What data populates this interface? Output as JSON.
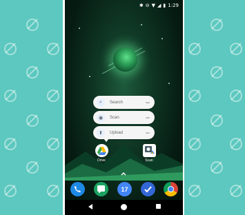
{
  "status_bar": {
    "time": "1:29"
  },
  "shortcuts": [
    {
      "label": "Search",
      "icon": "search-icon"
    },
    {
      "label": "Scan",
      "icon": "camera-icon"
    },
    {
      "label": "Upload",
      "icon": "upload-icon"
    }
  ],
  "home_apps": [
    {
      "label": "Drive",
      "icon": "google-drive-icon"
    },
    {
      "label": "Scan",
      "icon": "drive-scan-icon"
    }
  ],
  "dock": [
    {
      "icon": "phone-icon",
      "color": "#1e88e5"
    },
    {
      "icon": "messages-icon",
      "color": "#1aa260"
    },
    {
      "icon": "calendar-icon",
      "label": "17",
      "color": "#4285f4"
    },
    {
      "icon": "tasks-icon",
      "color": "#3367d6"
    },
    {
      "icon": "chrome-icon",
      "color": "#db4437"
    }
  ],
  "colors": {
    "side_panel": "#5cc8bf",
    "wallpaper": "#0f3624",
    "popup": "#f5f5f5"
  }
}
